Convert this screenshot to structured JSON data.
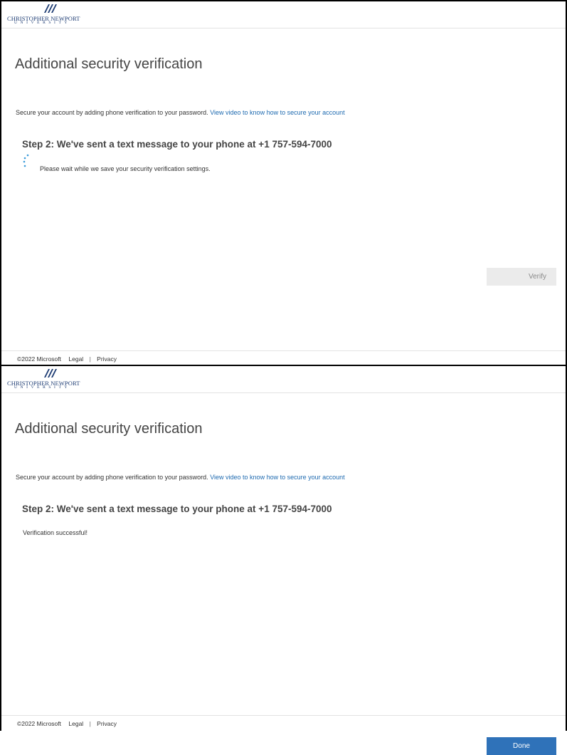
{
  "colors": {
    "link": "#1e6ab0",
    "done_button": "#2f72b9",
    "verify_button_bg": "#ebebeb",
    "brand": "#1b3a72"
  },
  "screens": [
    {
      "brand": {
        "name": "Christopher Newport",
        "sub": "University",
        "icon": "cnu-logo-icon"
      },
      "title": "Additional security verification",
      "intro": "Secure your account by adding phone verification to your password.",
      "intro_link": "View video to know how to secure your account",
      "step_heading": "Step 2: We've sent a text message to your phone at +1 757-594-7000",
      "status_text": "Please wait while we save your security verification settings.",
      "spinner_icon": "loading-spinner-icon",
      "button_label": "Verify",
      "footer": {
        "copyright": "©2022 Microsoft",
        "legal": "Legal",
        "separator": "|",
        "privacy": "Privacy"
      }
    },
    {
      "brand": {
        "name": "Christopher Newport",
        "sub": "University",
        "icon": "cnu-logo-icon"
      },
      "title": "Additional security verification",
      "intro": "Secure your account by adding phone verification to your password.",
      "intro_link": "View video to know how to secure your account",
      "step_heading": "Step 2: We've sent a text message to your phone at +1 757-594-7000",
      "status_text": "Verification successful!",
      "button_label": "Done",
      "footer": {
        "copyright": "©2022 Microsoft",
        "legal": "Legal",
        "separator": "|",
        "privacy": "Privacy"
      }
    }
  ]
}
